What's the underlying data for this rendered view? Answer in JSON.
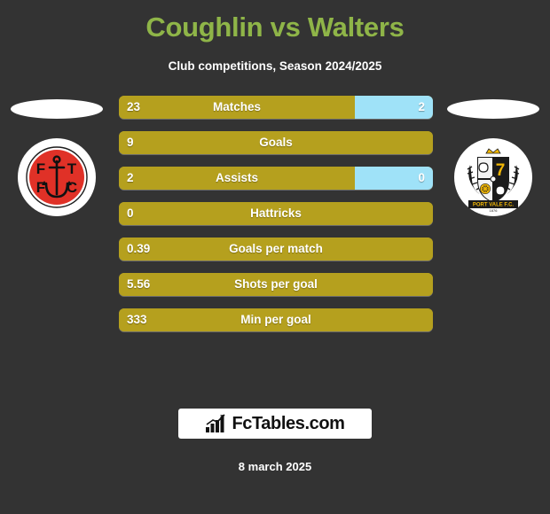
{
  "header": {
    "title": "Coughlin vs Walters",
    "subtitle": "Club competitions, Season 2024/2025",
    "title_color": "#8fb548",
    "subtitle_color": "#ffffff"
  },
  "theme": {
    "background": "#333333",
    "home_bar_color": "#b5a01e",
    "away_bar_color": "#9fe2f8",
    "text_color": "#ffffff"
  },
  "teams": {
    "home": {
      "crest_name": "fleetwood-town-fc-crest",
      "crest_caption": "F T F C",
      "primary_color": "#e03127"
    },
    "away": {
      "crest_name": "port-vale-fc-crest",
      "crest_caption": "PORT VALE F.C.",
      "crest_year": "1876",
      "primary_color": "#f2b705"
    }
  },
  "stats": [
    {
      "label": "Matches",
      "home": "23",
      "away": "2",
      "split": true
    },
    {
      "label": "Goals",
      "home": "9",
      "away": "",
      "split": false
    },
    {
      "label": "Assists",
      "home": "2",
      "away": "0",
      "split": true
    },
    {
      "label": "Hattricks",
      "home": "0",
      "away": "",
      "split": false
    },
    {
      "label": "Goals per match",
      "home": "0.39",
      "away": "",
      "split": false
    },
    {
      "label": "Shots per goal",
      "home": "5.56",
      "away": "",
      "split": false
    },
    {
      "label": "Min per goal",
      "home": "333",
      "away": "",
      "split": false
    }
  ],
  "footer": {
    "brand": "FcTables.com",
    "brand_icon": "bar-chart-growth-icon",
    "date": "8 march 2025"
  }
}
